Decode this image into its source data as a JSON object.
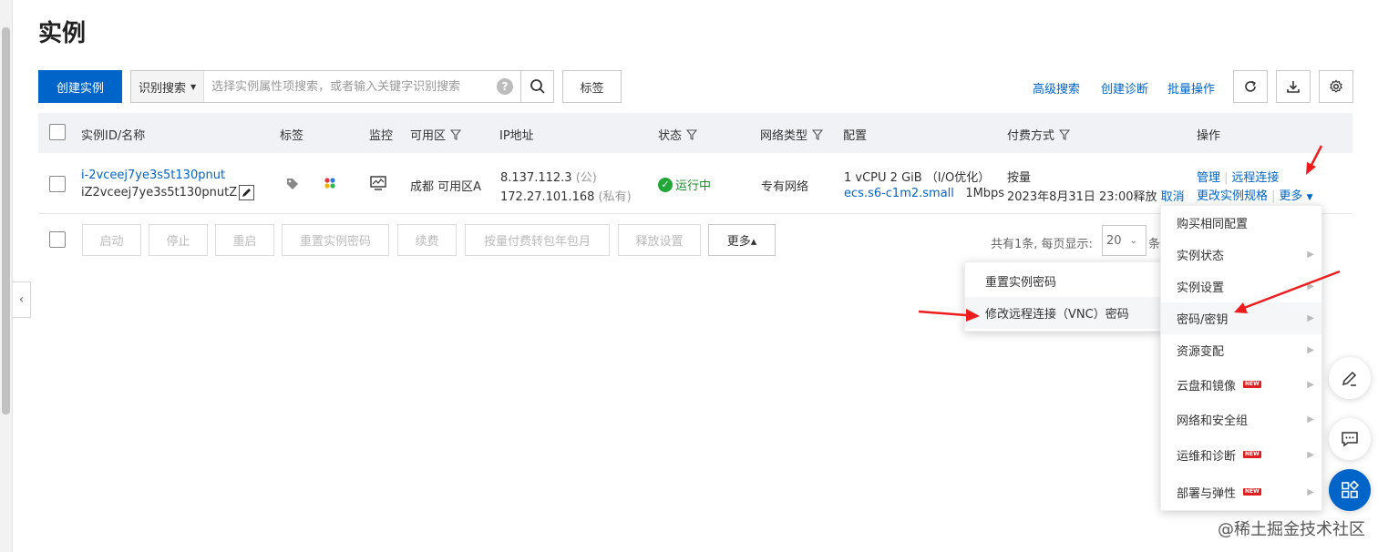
{
  "page": {
    "title": "实例"
  },
  "toolbar": {
    "create_label": "创建实例",
    "search_mode": "识别搜索",
    "search_placeholder": "选择实例属性项搜索，或者输入关键字识别搜索",
    "tag_label": "标签",
    "advanced_search": "高级搜索",
    "create_diagnosis": "创建诊断",
    "batch_ops": "批量操作",
    "icons": [
      "refresh-icon",
      "download-icon",
      "gear-icon"
    ]
  },
  "table": {
    "headers": {
      "id": "实例ID/名称",
      "tags": "标签",
      "monitor": "监控",
      "zone": "可用区",
      "ip": "IP地址",
      "status": "状态",
      "network": "网络类型",
      "config": "配置",
      "billing": "付费方式",
      "actions": "操作"
    },
    "rows": [
      {
        "instance_id": "i-2vceej7ye3s5t130pnut",
        "instance_name": "iZ2vceej7ye3s5t130pnutZ",
        "zone": "成都 可用区A",
        "public_ip": "8.137.112.3",
        "public_tag": "(公)",
        "private_ip": "172.27.101.168",
        "private_tag": "(私有)",
        "status": "运行中",
        "network": "专有网络",
        "config_line1": "1 vCPU 2 GiB （I/O优化）",
        "config_type": "ecs.s6-c1m2.small",
        "bandwidth": "1Mbps",
        "billing": "按量",
        "release_time": "2023年8月31日 23:00释放",
        "cancel": "取消",
        "action_manage": "管理",
        "action_remote": "远程连接",
        "action_change_spec": "更改实例规格",
        "action_more": "更多"
      }
    ]
  },
  "batch": {
    "buttons": [
      "启动",
      "停止",
      "重启",
      "重置实例密码",
      "续费",
      "按量付费转包年包月",
      "释放设置"
    ],
    "more_label": "更多▴"
  },
  "pager": {
    "summary": "共有1条, 每页显示:",
    "page_size": "20",
    "tail": "条"
  },
  "more_menu": {
    "items": [
      {
        "label": "购买相同配置",
        "submenu": false,
        "new": false
      },
      {
        "label": "实例状态",
        "submenu": true,
        "new": false
      },
      {
        "label": "实例设置",
        "submenu": true,
        "new": false
      },
      {
        "label": "密码/密钥",
        "submenu": true,
        "new": false
      },
      {
        "label": "资源变配",
        "submenu": true,
        "new": false
      },
      {
        "label": "云盘和镜像",
        "submenu": true,
        "new": true
      },
      {
        "label": "网络和安全组",
        "submenu": true,
        "new": false
      },
      {
        "label": "运维和诊断",
        "submenu": true,
        "new": true
      },
      {
        "label": "部署与弹性",
        "submenu": true,
        "new": true
      }
    ],
    "new_badge": "NEW"
  },
  "password_submenu": {
    "items": [
      "重置实例密码",
      "修改远程连接（VNC）密码"
    ]
  },
  "watermark": "@稀土掘金技术社区",
  "colors": {
    "primary": "#0064c8",
    "success": "#20a737",
    "annotation": "#ee1c1c"
  }
}
